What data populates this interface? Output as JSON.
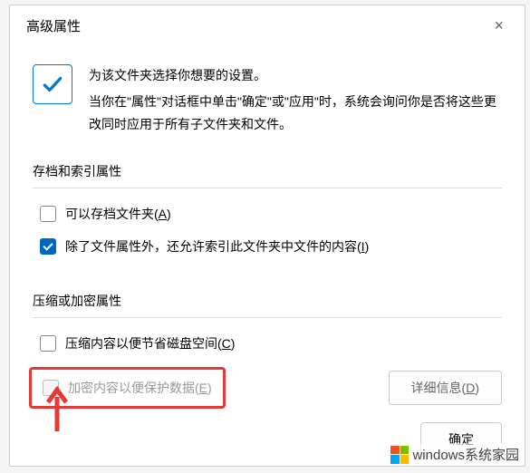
{
  "dialog": {
    "title": "高级属性",
    "close": "×",
    "header": {
      "line1": "为该文件夹选择你想要的设置。",
      "line2": "当你在\"属性\"对话框中单击\"确定\"或\"应用\"时，系统会询问你是否将这些更改同时应用于所有子文件夹和文件。"
    },
    "group_archive": {
      "title": "存档和索引属性",
      "archive_label": "可以存档文件夹(",
      "archive_key": "A",
      "archive_close": ")",
      "index_label": "除了文件属性外，还允许索引此文件夹中文件的内容(",
      "index_key": "I",
      "index_close": ")"
    },
    "group_compress": {
      "title": "压缩或加密属性",
      "compress_label": "压缩内容以便节省磁盘空间(",
      "compress_key": "C",
      "compress_close": ")",
      "encrypt_label": "加密内容以便保护数据(",
      "encrypt_key": "E",
      "encrypt_close": ")",
      "details_label": "详细信息(",
      "details_key": "D",
      "details_close": ")"
    },
    "buttons": {
      "ok": "确定"
    }
  },
  "watermark": {
    "text": "windows系统家园"
  }
}
